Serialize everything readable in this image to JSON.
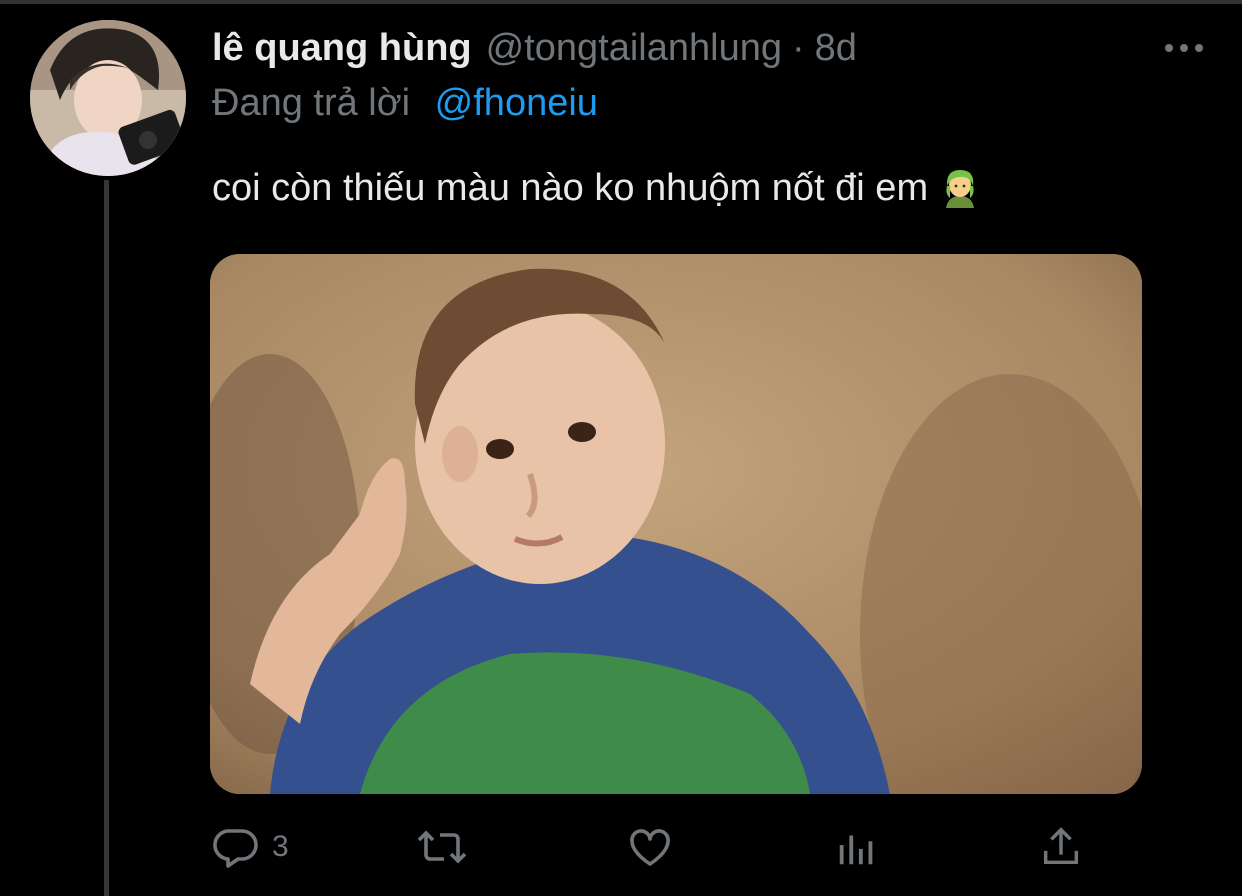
{
  "tweet": {
    "display_name": "lê quang hùng",
    "handle": "@tongtailanhlung",
    "separator": "·",
    "time": "8d",
    "reply_prefix": "Đang trả lời",
    "reply_to": "@fhoneiu",
    "text": "coi còn thiếu màu nào ko nhuộm nốt đi em",
    "emoji": "green-haired-person-emoji"
  },
  "actions": {
    "reply_count": "3",
    "reply_icon": "reply-icon",
    "retweet_icon": "retweet-icon",
    "like_icon": "heart-icon",
    "analytics_icon": "analytics-icon",
    "share_icon": "share-icon"
  },
  "colors": {
    "background": "#000000",
    "primary_text": "#e7e9ea",
    "secondary_text": "#71767b",
    "link": "#1d9bf0",
    "thread_line": "#333639"
  }
}
